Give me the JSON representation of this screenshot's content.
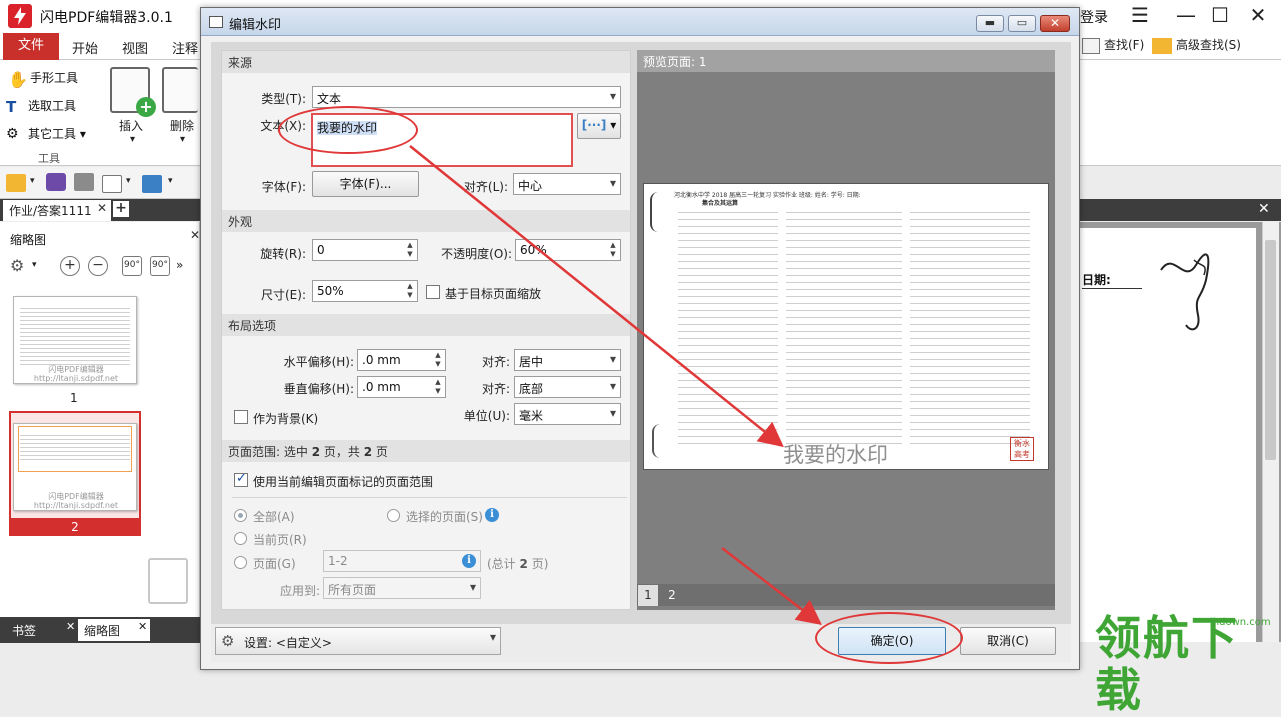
{
  "app": {
    "title": "闪电PDF编辑器3.0.1",
    "login": "登录",
    "ribbon_tabs": [
      "文件",
      "开始",
      "视图",
      "注释"
    ],
    "tools": [
      "手形工具",
      "选取工具",
      "其它工具"
    ],
    "tools_group_label": "工具",
    "insert_label": "插入",
    "delete_label": "删除",
    "search_label": "查找(F)",
    "advanced_search_label": "高级查找(S)",
    "doc_tab": "作业/答案1111",
    "thumb_panel_title": "缩略图",
    "thumb_page_1": "1",
    "thumb_page_2": "2",
    "thumb_watermark_line1": "闪电PDF编辑器",
    "thumb_watermark_line2": "http://ltanji.sdpdf.net",
    "bottom_tab_bookmark": "书签",
    "bottom_tab_thumbnail": "缩略图",
    "right_doc_date_label": "日期:",
    "site_watermark": "领航下载",
    "site_watermark_url": "lhdown.com"
  },
  "dialog": {
    "title": "编辑水印",
    "source_section": "来源",
    "type_label": "类型(T):",
    "type_value": "文本",
    "text_label": "文本(X):",
    "text_value": "我要的水印",
    "font_label": "字体(F):",
    "font_button": "字体(F)...",
    "align_label": "对齐(L):",
    "align_value": "中心",
    "appearance_section": "外观",
    "rotation_label": "旋转(R):",
    "rotation_value": "0",
    "opacity_label": "不透明度(O):",
    "opacity_value": "60%",
    "size_label": "尺寸(E):",
    "size_value": "50%",
    "scale_to_page_label": "基于目标页面缩放",
    "layout_section": "布局选项",
    "h_offset_label": "水平偏移(H):",
    "h_offset_value": ".0 mm",
    "h_align_label": "对齐:",
    "h_align_value": "居中",
    "v_offset_label": "垂直偏移(H):",
    "v_offset_value": ".0 mm",
    "v_align_label": "对齐:",
    "v_align_value": "底部",
    "as_background_label": "作为背景(K)",
    "unit_label": "单位(U):",
    "unit_value": "毫米",
    "page_range_prefix": "页面范围: 选中",
    "page_range_selected": "2",
    "page_range_mid": "页，共",
    "page_range_total": "2",
    "page_range_suffix": "页",
    "use_marked_range_label": "使用当前编辑页面标记的页面范围",
    "all_label": "全部(A)",
    "selected_pages_label": "选择的页面(S)",
    "current_page_label": "当前页(R)",
    "pages_label": "页面(G)",
    "pages_value": "1-2",
    "total_pages_prefix": "(总计",
    "total_pages_num": "2",
    "total_pages_suffix": "页)",
    "apply_to_label": "应用到:",
    "apply_to_value": "所有页面",
    "preview_header": "预览页面: 1",
    "preview_page_title": "河北衡水中学 2018 届高三一轮复习   实验作业   班级:        姓名:        学号:        日期:",
    "preview_section_title": "集合及其运算",
    "preview_watermark": "我要的水印",
    "preview_seal": "衡水 高考",
    "preview_pages": [
      "1",
      "2"
    ],
    "settings_label": "设置: <自定义>",
    "ok_button": "确定(O)",
    "cancel_button": "取消(C)"
  },
  "colors": {
    "brand_red": "#d9222a",
    "annotation_red": "#e03838",
    "site_green": "#3fa535"
  }
}
